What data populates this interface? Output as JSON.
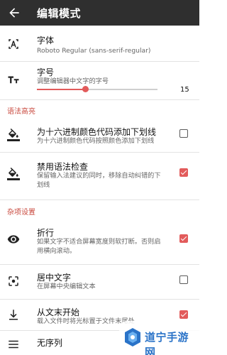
{
  "appbar": {
    "title": "编辑模式",
    "back_icon": "arrow-left-icon"
  },
  "font": {
    "title": "字体",
    "value": "Roboto Regular (sans-serif-regular)",
    "icon": "font-icon"
  },
  "font_size": {
    "title": "字号",
    "desc": "调整编辑器中文字的字号",
    "value": "15",
    "slider_fraction": 0.4,
    "icon": "text-size-icon"
  },
  "sections": {
    "syntax": "语法高亮",
    "misc": "杂项设置"
  },
  "syntax_items": [
    {
      "title": "为十六进制颜色代码添加下划线",
      "desc": "为十六进制颜色代码按照颜色添加下划线",
      "checked": false,
      "icon": "format-color-icon"
    },
    {
      "title": "禁用语法检查",
      "desc": "保留输入法建议的同时，移除自动纠错的下划线",
      "checked": true,
      "icon": "format-color-icon"
    }
  ],
  "misc_items": [
    {
      "title": "折行",
      "desc": "如果文字不适合屏幕宽度则软打断。否则启用横向滚动。",
      "checked": true,
      "icon": "eye-icon"
    },
    {
      "title": "居中文字",
      "desc": "在屏幕中央编辑文本",
      "checked": false,
      "icon": "center-focus-icon"
    },
    {
      "title": "从文末开始",
      "desc": "载入文件时将光标置于文件末尾处",
      "checked": true,
      "icon": "arrow-down-bar-icon"
    },
    {
      "title": "无序列",
      "desc": "",
      "checked": false,
      "icon": "list-icon"
    }
  ],
  "watermark": {
    "text": "道宁手游网"
  },
  "colors": {
    "appbar": "#2f2f2f",
    "accent": "#e25b5b",
    "section": "#c94a3f"
  }
}
